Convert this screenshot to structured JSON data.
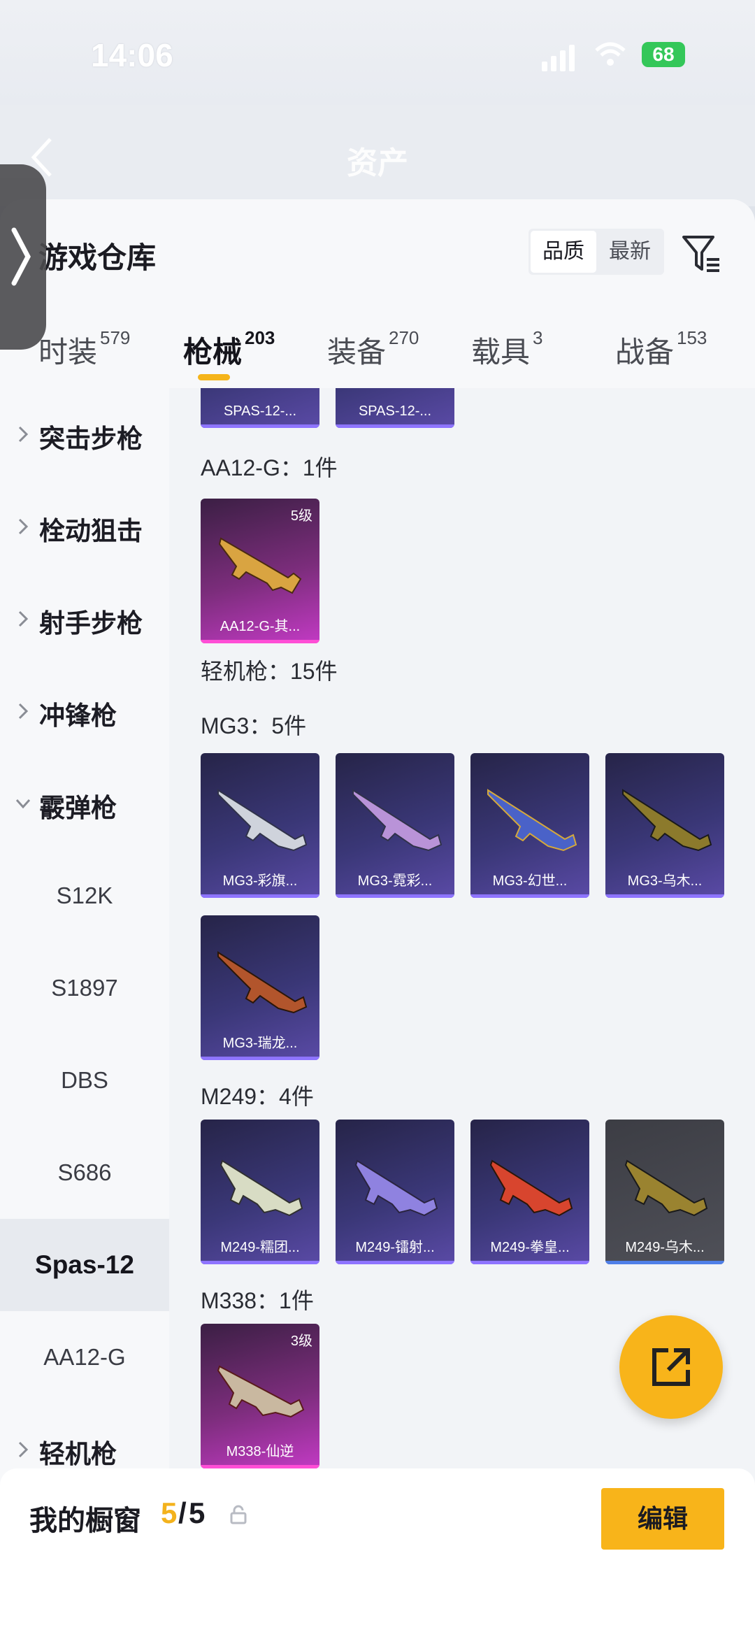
{
  "status": {
    "time": "14:06",
    "battery": "68"
  },
  "nav": {
    "title": "资产"
  },
  "sheet": {
    "title": "游戏仓库"
  },
  "sort": {
    "quality": "品质",
    "latest": "最新"
  },
  "tabs": [
    {
      "label": "时装",
      "count": "579"
    },
    {
      "label": "枪械",
      "count": "203"
    },
    {
      "label": "装备",
      "count": "270"
    },
    {
      "label": "载具",
      "count": "3"
    },
    {
      "label": "战备",
      "count": "153"
    }
  ],
  "sidebar": {
    "categories": [
      "突击步枪",
      "栓动狙击",
      "射手步枪",
      "冲锋枪",
      "霰弹枪"
    ],
    "shotguns": [
      "S12K",
      "S1897",
      "DBS",
      "S686",
      "Spas-12",
      "AA12-G"
    ],
    "lmg": "轻机枪"
  },
  "content": {
    "top_cards": [
      "SPAS-12-...",
      "SPAS-12-..."
    ],
    "aa12": {
      "title": "AA12-G：1件",
      "card": "AA12-G-其...",
      "level": "5级"
    },
    "lmg_title": "轻机枪：15件",
    "mg3": {
      "title": "MG3：5件",
      "cards": [
        "MG3-彩旗...",
        "MG3-霓彩...",
        "MG3-幻世...",
        "MG3-乌木...",
        "MG3-瑞龙..."
      ]
    },
    "m249": {
      "title": "M249：4件",
      "cards": [
        "M249-糯团...",
        "M249-镭射...",
        "M249-拳皇...",
        "M249-乌木..."
      ]
    },
    "m338": {
      "title": "M338：1件",
      "card": "M338-仙逆",
      "level": "3级"
    }
  },
  "showcase": {
    "label": "我的橱窗",
    "used": "5",
    "sep": "/",
    "total": "5",
    "edit": "编辑"
  },
  "colors": {
    "accent": "#f8b41a",
    "card_purple": "#3a3777",
    "card_pink": "#c23ac4"
  }
}
